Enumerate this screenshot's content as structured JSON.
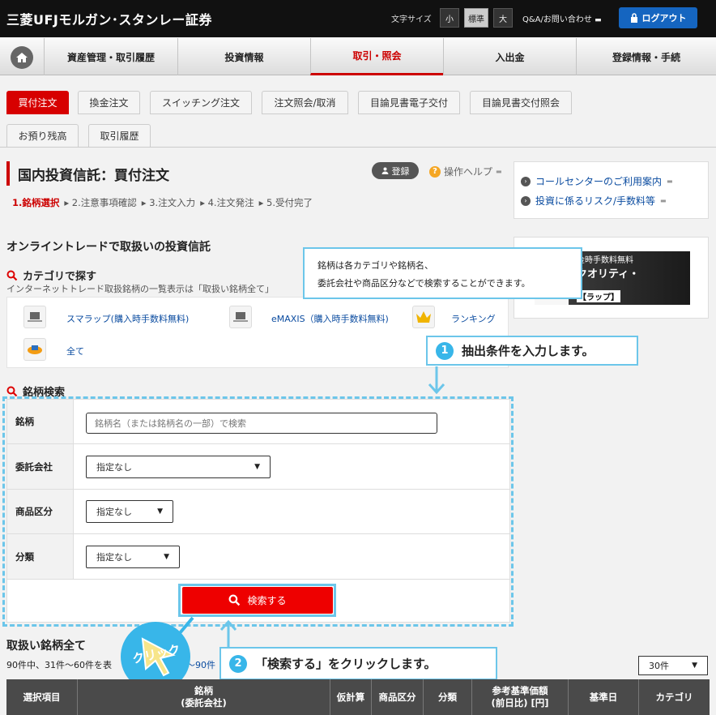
{
  "header": {
    "brand": "三菱UFJモルガン･スタンレー証券",
    "font_size_label": "文字サイズ",
    "font_sizes": [
      "小",
      "標準",
      "大"
    ],
    "qa_link": "Q&A/お問い合わせ",
    "logout": "ログアウト"
  },
  "global_nav": [
    "資産管理・取引履歴",
    "投資情報",
    "取引・照会",
    "入出金",
    "登録情報・手続"
  ],
  "tabs_row1": [
    "買付注文",
    "換金注文",
    "スイッチング注文",
    "注文照会/取消",
    "目論見書電子交付",
    "目論見書交付照会"
  ],
  "tabs_row2": [
    "お預り残高",
    "取引履歴"
  ],
  "page": {
    "title": "国内投資信託：買付注文",
    "register": "登録",
    "help": "操作ヘルプ",
    "steps": [
      "1.銘柄選択",
      "▸ 2.注意事項確認",
      "▸ 3.注文入力",
      "▸ 4.注文発注",
      "▸ 5.受付完了"
    ]
  },
  "sidebar": {
    "links": [
      "コールセンターのご利用案内",
      "投資に係るリスク/手数料等"
    ],
    "banner": {
      "line1": "金時手数料無料",
      "line2": "クオリティ・",
      "line3": "【ラップ】"
    }
  },
  "online": {
    "heading": "オンライントレードで取扱いの投資信託",
    "cat_heading": "カテゴリで探す",
    "cat_desc": "インターネットトレード取扱銘柄の一覧表示は「取扱い銘柄全て」",
    "categories": [
      "スマラップ(購入時手数料無料)",
      "eMAXIS（購入時手数料無料)",
      "ランキング",
      "全て"
    ]
  },
  "callout1": {
    "line1": "銘柄は各カテゴリや銘柄名、",
    "line2": "委託会社や商品区分などで検索することができます。"
  },
  "step1": {
    "num": "1",
    "text": "抽出条件を入力します。"
  },
  "search": {
    "heading": "銘柄検索",
    "labels": [
      "銘柄",
      "委託会社",
      "商品区分",
      "分類"
    ],
    "name_placeholder": "銘柄名（または銘柄名の一部）で検索",
    "select_default": "指定なし",
    "button": "検索する"
  },
  "click_label": "クリック",
  "step2": {
    "num": "2",
    "text": "「検索する」をクリックします。"
  },
  "results": {
    "heading": "取扱い銘柄全て",
    "count": "90件中、31件〜60件を表",
    "count_tail": "～90件",
    "per_page": "30件",
    "columns": [
      "選択項目",
      "銘柄\n(委託会社)",
      "仮計算",
      "商品区分",
      "分類",
      "参考基準価額\n(前日比) [円]",
      "基準日",
      "カテゴリ"
    ]
  },
  "colors": {
    "accent_red": "#d70000",
    "highlight_blue": "#6cc6ea",
    "link_blue": "#0b4ca0"
  }
}
